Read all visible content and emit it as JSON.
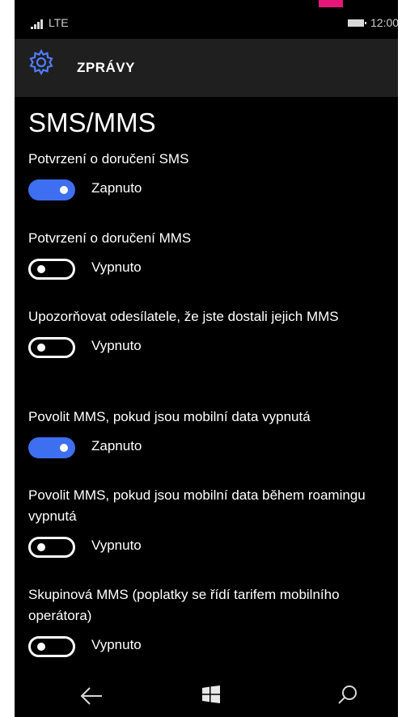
{
  "status_bar": {
    "network": "LTE",
    "time": "12:00"
  },
  "app_bar": {
    "title": "ZPRÁVY",
    "icon": "gear-icon"
  },
  "page": {
    "title": "SMS/MMS"
  },
  "settings": [
    {
      "label": "Potvrzení o doručení SMS",
      "state": "Zapnuto",
      "on": true
    },
    {
      "label": "Potvrzení o doručení MMS",
      "state": "Vypnuto",
      "on": false
    },
    {
      "label": "Upozorňovat odesílatele, že jste dostali jejich MMS",
      "state": "Vypnuto",
      "on": false
    },
    {
      "label": "Povolit MMS, pokud jsou mobilní data vypnutá",
      "state": "Zapnuto",
      "on": true
    },
    {
      "label": "Povolit MMS, pokud jsou mobilní data během roamingu vypnutá",
      "state": "Vypnuto",
      "on": false
    },
    {
      "label": "Skupinová MMS (poplatky se řídí tarifem mobilního operátora)",
      "state": "Vypnuto",
      "on": false
    }
  ],
  "nav_bar": {
    "back_icon": "back-arrow-icon",
    "start_icon": "windows-start-icon",
    "search_icon": "search-icon"
  },
  "colors": {
    "accent": "#3e6ff0",
    "background": "#000000",
    "app_bar": "#1f1f1f",
    "marker": "#e6167a"
  }
}
